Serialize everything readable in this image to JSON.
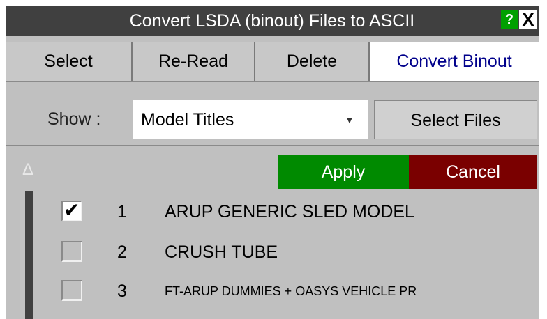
{
  "window": {
    "title": "Convert LSDA (binout) Files to ASCII",
    "help_label": "?",
    "close_label": "X"
  },
  "tabs": [
    {
      "label": "Select"
    },
    {
      "label": "Re-Read"
    },
    {
      "label": "Delete"
    },
    {
      "label": "Convert Binout",
      "active": true
    }
  ],
  "show": {
    "label": "Show :",
    "selected": "Model Titles",
    "select_files_label": "Select Files"
  },
  "actions": {
    "apply_label": "Apply",
    "cancel_label": "Cancel"
  },
  "models": [
    {
      "num": "1",
      "title": "ARUP GENERIC SLED MODEL",
      "checked": true
    },
    {
      "num": "2",
      "title": "CRUSH TUBE",
      "checked": false
    },
    {
      "num": "3",
      "title": "FT-ARUP DUMMIES + OASYS VEHICLE PR",
      "checked": false
    }
  ],
  "colors": {
    "title_bar": "#404040",
    "apply": "#008a00",
    "cancel": "#7a0000",
    "active_tab_text": "#00008b"
  }
}
